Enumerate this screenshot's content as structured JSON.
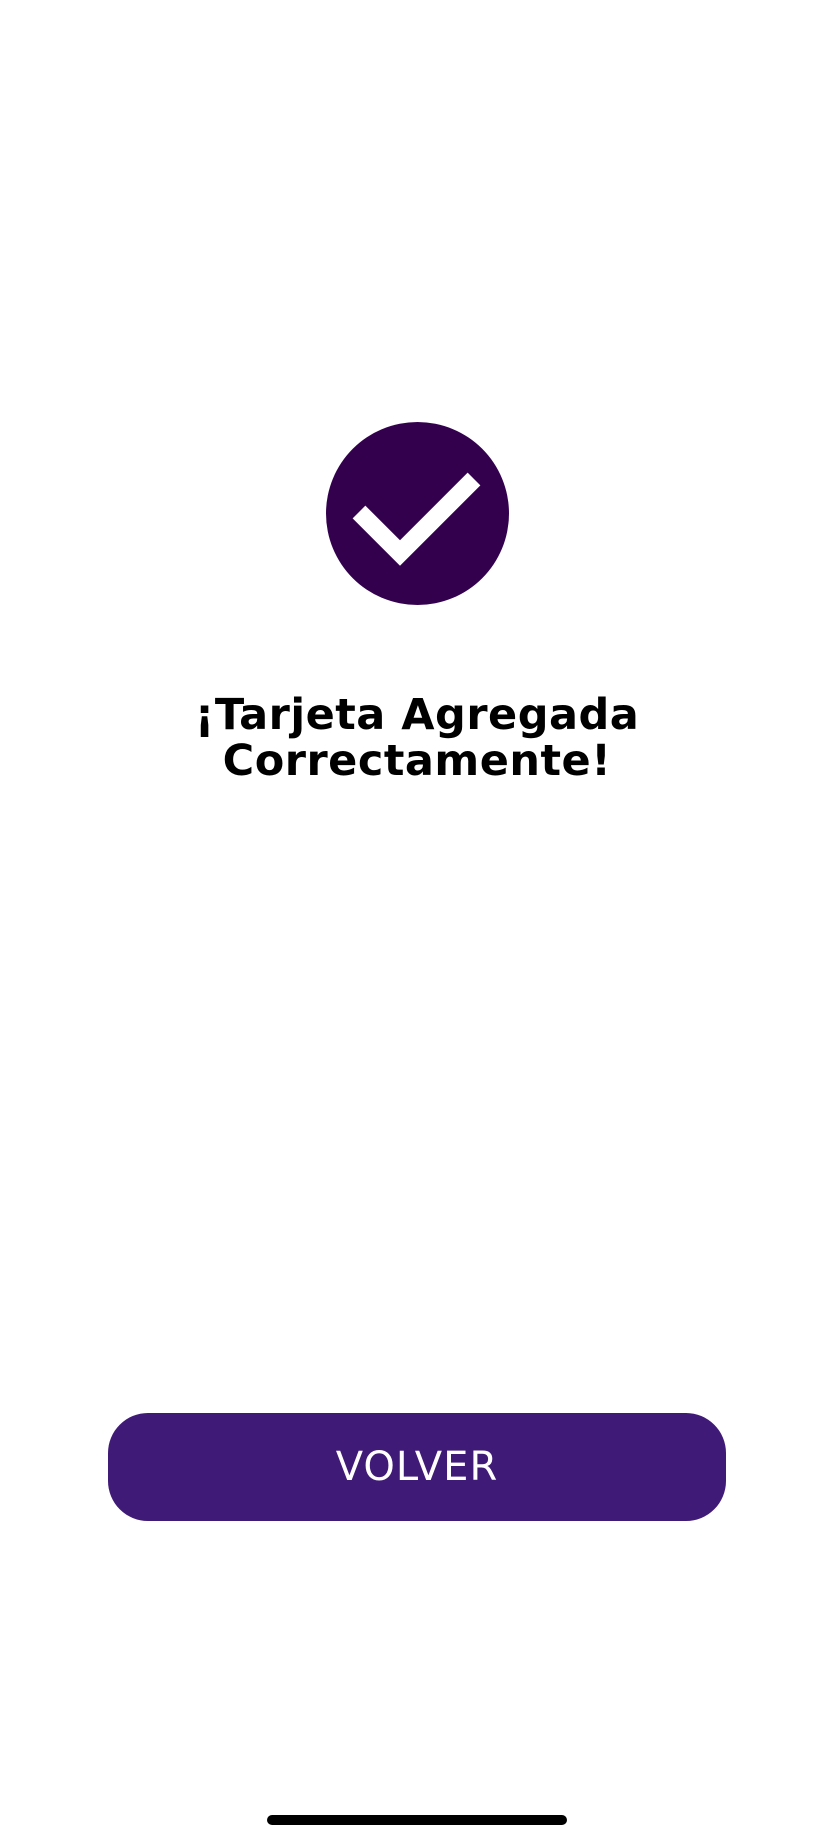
{
  "screen": {
    "title_line1": "¡Tarjeta Agregada",
    "title_line2": "Correctamente!"
  },
  "actions": {
    "back_label": "VOLVER"
  },
  "icons": {
    "success": "checkmark-icon"
  },
  "colors": {
    "success_circle": "#33004d",
    "button_background": "#401a77",
    "button_text": "#ffffff",
    "background": "#ffffff"
  }
}
